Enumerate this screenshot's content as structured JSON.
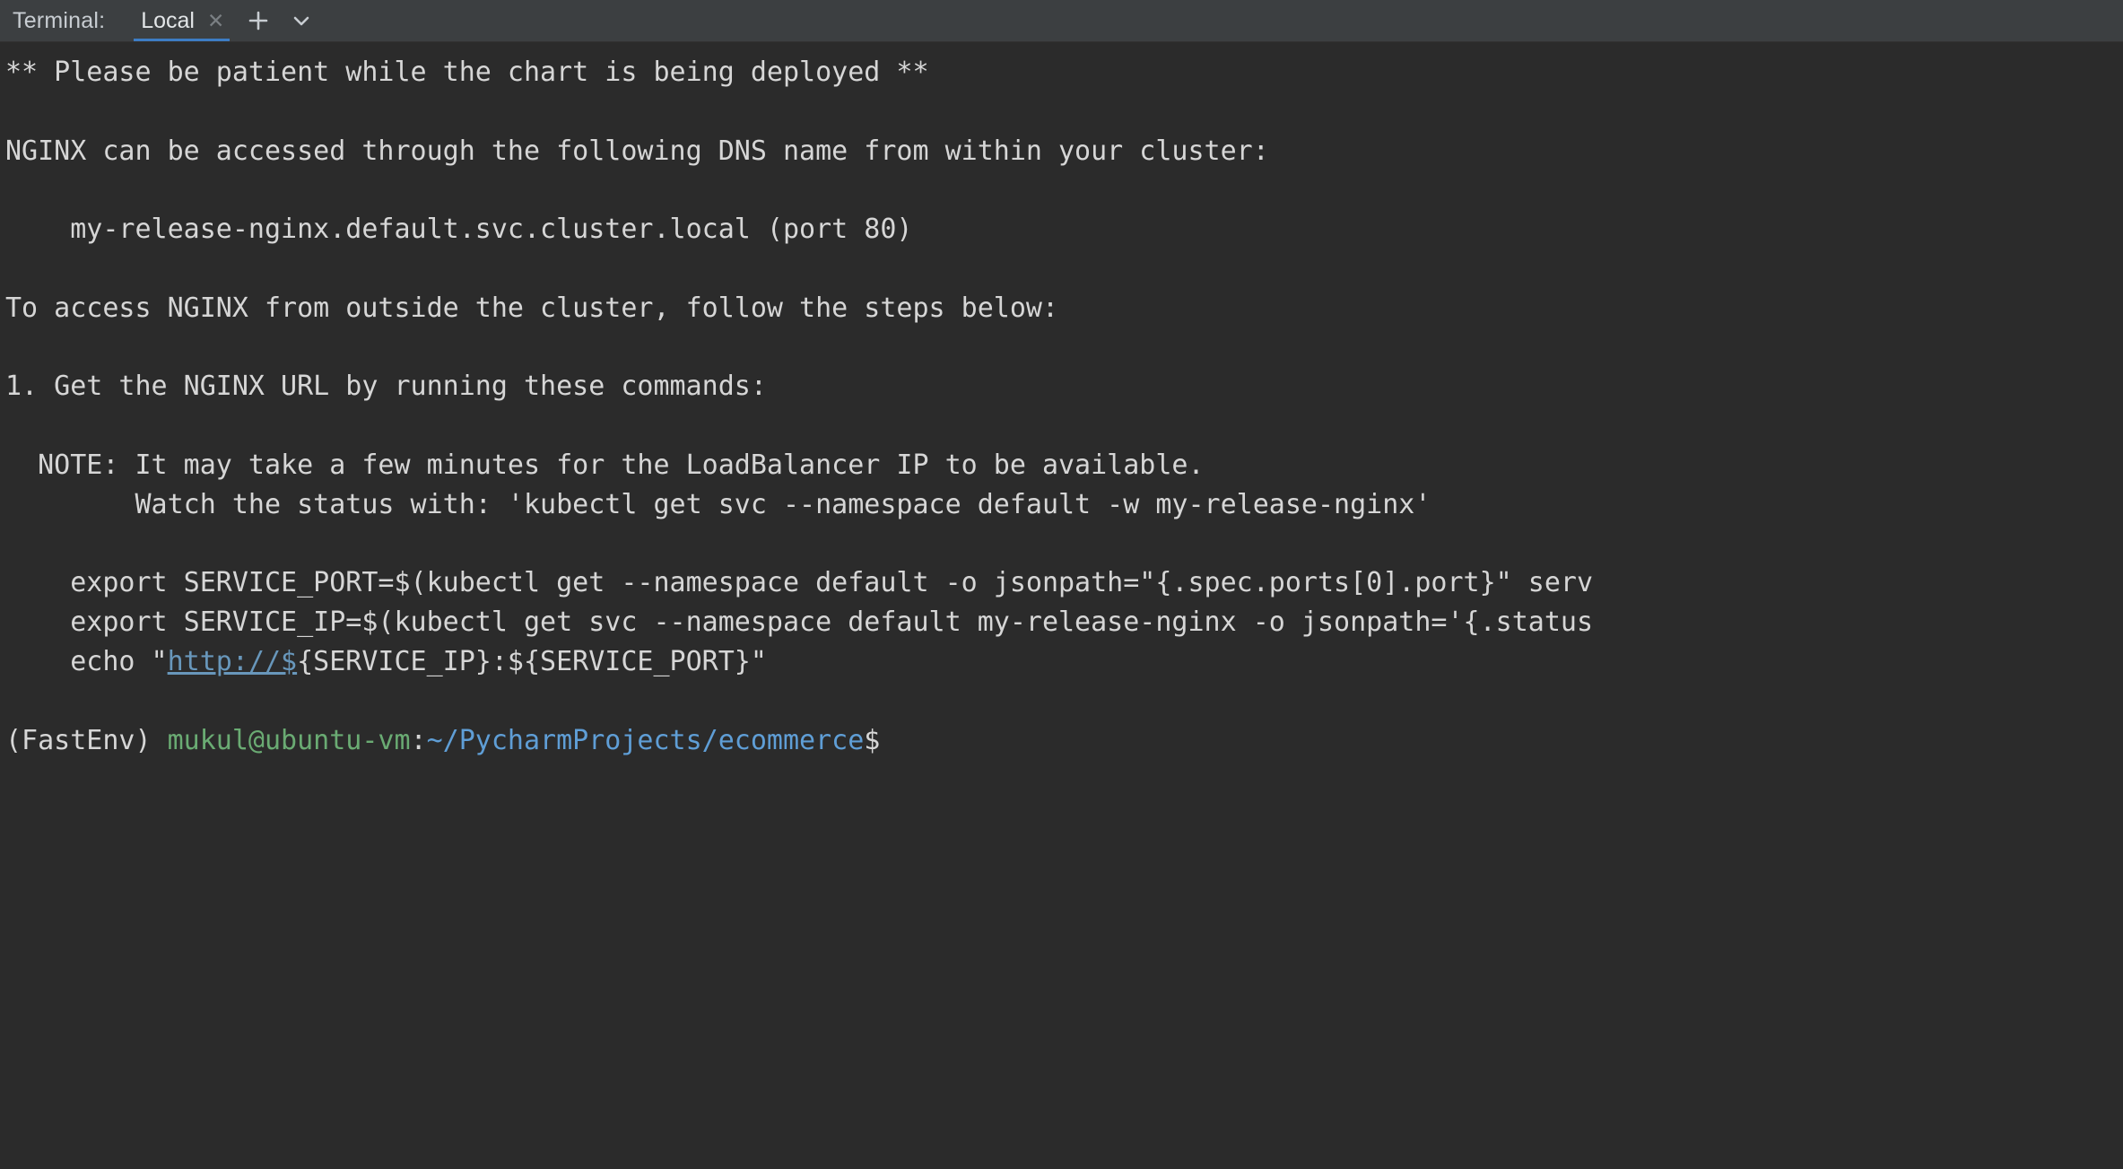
{
  "header": {
    "tool_label": "Terminal:",
    "tabs": [
      {
        "label": "Local",
        "close_icon": "close-icon",
        "active": true
      }
    ],
    "add_button_icon": "plus-icon",
    "dropdown_button_icon": "chevron-down-icon",
    "accent_color": "#3d7dc4",
    "background_color": "#3c3f41"
  },
  "terminal": {
    "background_color": "#2b2b2b",
    "foreground_color": "#d6d6d6",
    "link_color": "#6897bb",
    "lines": [
      "** Please be patient while the chart is being deployed **",
      "",
      "NGINX can be accessed through the following DNS name from within your cluster:",
      "",
      "    my-release-nginx.default.svc.cluster.local (port 80)",
      "",
      "To access NGINX from outside the cluster, follow the steps below:",
      "",
      "1. Get the NGINX URL by running these commands:",
      "",
      "  NOTE: It may take a few minutes for the LoadBalancer IP to be available.",
      "        Watch the status with: 'kubectl get svc --namespace default -w my-release-nginx'",
      "",
      "    export SERVICE_PORT=$(kubectl get --namespace default -o jsonpath=\"{.spec.ports[0].port}\" serv",
      "    export SERVICE_IP=$(kubectl get svc --namespace default my-release-nginx -o jsonpath='{.status",
      "    echo \"http://${SERVICE_IP}:${SERVICE_PORT}\"",
      ""
    ],
    "echo_line": {
      "prefix": "    echo \"",
      "link": "http://$",
      "suffix": "{SERVICE_IP}:${SERVICE_PORT}\""
    },
    "prompt": {
      "venv": "(FastEnv) ",
      "user_host": "mukul@ubuntu-vm",
      "separator": ":",
      "path": "~/PycharmProjects/ecommerce",
      "symbol": "$",
      "venv_color": "#d6d6d6",
      "user_host_color": "#6aab73",
      "path_color": "#5f9ed6"
    }
  }
}
